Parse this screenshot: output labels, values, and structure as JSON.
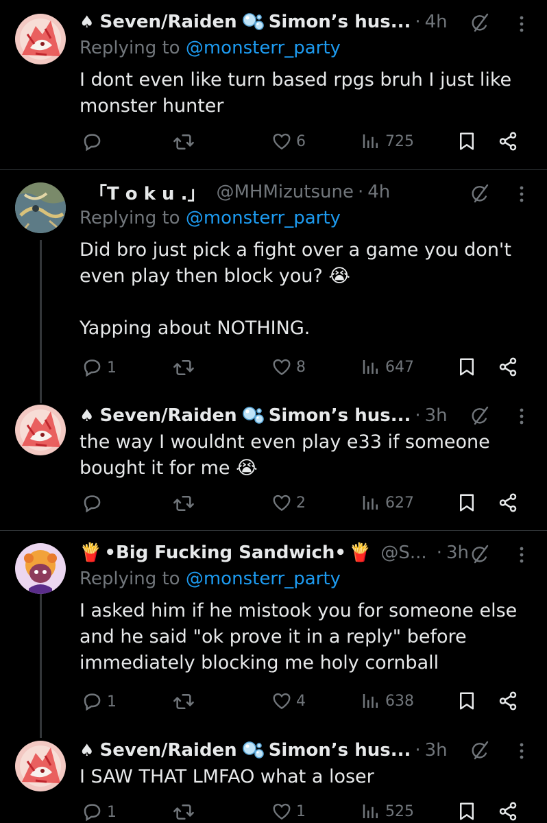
{
  "tweets": [
    {
      "display_name": "Seven/Raiden",
      "badge": "Simon’s hus...",
      "dot": "·",
      "time": "4h",
      "replying_prefix": "Replying to",
      "mention": "@monsterr_party",
      "text_lines": [
        "I dont even like turn based rpgs bruh I just like",
        "monster hunter"
      ],
      "reply_count": "",
      "retweet_count": "",
      "like_count": "6",
      "view_count": "725"
    },
    {
      "display_name": "「T o k u .」",
      "handle": "@MHMizutsune",
      "dot": "·",
      "time": "4h",
      "replying_prefix": "Replying to",
      "mention": "@monsterr_party",
      "text_lines": [
        "Did bro just pick a fight over a game you don't",
        "even play then block you? 😭",
        "",
        "Yapping about NOTHING."
      ],
      "reply_count": "1",
      "retweet_count": "",
      "like_count": "8",
      "view_count": "647"
    },
    {
      "display_name": "Seven/Raiden",
      "badge": "Simon’s hus...",
      "dot": "·",
      "time": "3h",
      "text_lines": [
        "the way I wouldnt even play e33 if someone",
        "bought it for me 😭"
      ],
      "reply_count": "",
      "retweet_count": "",
      "like_count": "2",
      "view_count": "627"
    },
    {
      "display_name": "•Big Fucking Sandwich•",
      "handle": "@S...",
      "dot": "·",
      "time": "3h",
      "replying_prefix": "Replying to",
      "mention": "@monsterr_party",
      "text_lines": [
        "I asked him if he mistook you for someone else",
        "and he said \"ok prove it in a reply\" before",
        "immediately blocking me holy cornball"
      ],
      "reply_count": "1",
      "retweet_count": "",
      "like_count": "4",
      "view_count": "638"
    },
    {
      "display_name": "Seven/Raiden",
      "badge": "Simon’s hus...",
      "dot": "·",
      "time": "3h",
      "text_lines": [
        "I SAW THAT LMFAO what a loser"
      ],
      "reply_count": "1",
      "retweet_count": "",
      "like_count": "1",
      "view_count": "525"
    }
  ],
  "icons": {
    "spade": "♠",
    "fries": "🍟",
    "bubbles": "bubbles-emoji-icon",
    "grok": "grok-icon",
    "more": "more-icon",
    "reply": "reply-icon",
    "retweet": "retweet-icon",
    "like": "heart-icon",
    "views": "views-icon",
    "bookmark": "bookmark-icon",
    "share": "share-icon"
  },
  "colors": {
    "background": "#000000",
    "text": "#e7e9ea",
    "secondary": "#71767b",
    "link": "#1d9bf0",
    "divider": "#2f3336"
  }
}
